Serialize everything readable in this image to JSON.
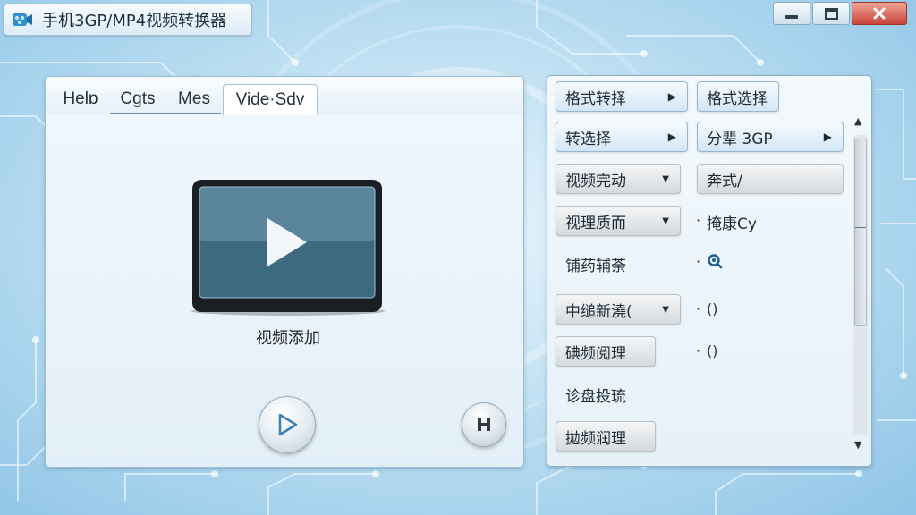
{
  "window": {
    "title": "手机3GP/MP4视频转换器",
    "icon": "film-reel-icon",
    "controls": [
      "minimize-icon",
      "maximize-icon",
      "close-icon"
    ],
    "close_color": "#c8443a"
  },
  "tabs": [
    {
      "label": "Hel⁠ɒ",
      "active": false
    },
    {
      "label": "Cgts",
      "active": false
    },
    {
      "label": "Mes",
      "active": false
    },
    {
      "label": "Vide·Sdv",
      "active": true
    }
  ],
  "preview": {
    "label": "视频添加",
    "icon": "play-icon"
  },
  "player": {
    "play_icon": "play-icon",
    "pause_icon": "pause-icon"
  },
  "right_panel": {
    "row1": {
      "left": "格式转择",
      "right": "格式选择"
    },
    "row2": {
      "left": "转选择",
      "right": "分辈 3GP"
    },
    "row3": {
      "left": "视频完动",
      "right": "奔式/"
    },
    "row4": {
      "left": "视理质而",
      "right": "掩康Cy"
    },
    "row5": {
      "left": "铺药辅荼"
    },
    "row6": {
      "left": "中缒新澆(",
      "right": "()"
    },
    "row7": {
      "left": "碘频阅理",
      "right": "()"
    },
    "row8": {
      "left": "诊盘投琉"
    },
    "row9": {
      "left": "拋频润理"
    }
  },
  "colors": {
    "accent": "#3a7fb8",
    "background": "#bfe0f3"
  }
}
